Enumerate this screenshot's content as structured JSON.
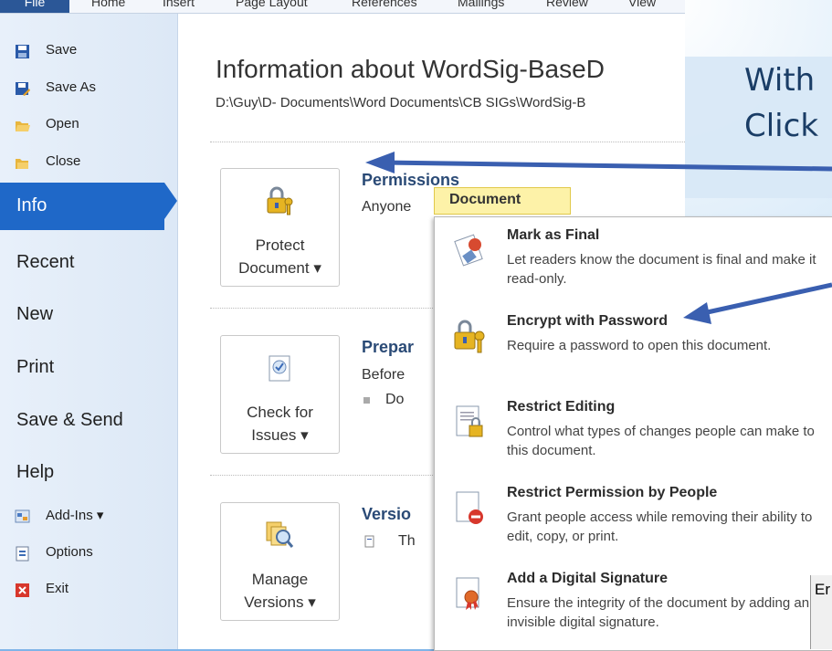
{
  "ribbon": {
    "tabs": [
      "File",
      "Home",
      "Insert",
      "Page Layout",
      "References",
      "Mailings",
      "Review",
      "View"
    ]
  },
  "sidebar": {
    "items": [
      {
        "label": "Save",
        "icon": "save-icon"
      },
      {
        "label": "Save As",
        "icon": "save-as-icon"
      },
      {
        "label": "Open",
        "icon": "open-folder-icon"
      },
      {
        "label": "Close",
        "icon": "close-folder-icon"
      },
      {
        "label": "Info"
      },
      {
        "label": "Recent"
      },
      {
        "label": "New"
      },
      {
        "label": "Print"
      },
      {
        "label": "Save & Send"
      },
      {
        "label": "Help"
      },
      {
        "label": "Add-Ins ▾",
        "icon": "add-ins-icon"
      },
      {
        "label": "Options",
        "icon": "options-icon"
      },
      {
        "label": "Exit",
        "icon": "exit-icon"
      }
    ]
  },
  "main": {
    "title": "Information about WordSig-BaseD",
    "path": "D:\\Guy\\D- Documents\\Word Documents\\CB SIGs\\WordSig-B",
    "sections": [
      {
        "button_line1": "Protect",
        "button_line2": "Document ▾",
        "heading": "Permissions",
        "text": "Anyone"
      },
      {
        "button_line1": "Check for",
        "button_line2": "Issues ▾",
        "heading": "Prepar",
        "text": "Before",
        "bullet": "Do"
      },
      {
        "button_line1": "Manage",
        "button_line2": "Versions ▾",
        "heading": "Versio",
        "text": "Th"
      }
    ]
  },
  "menu": {
    "tooltip": "Document",
    "items": [
      {
        "title": "Mark as Final",
        "desc": "Let readers know the document is final and make it read-only."
      },
      {
        "title": "Encrypt with Password",
        "desc": "Require a password to open this document."
      },
      {
        "title": "Restrict Editing",
        "desc": "Control what types of changes people can make to this document."
      },
      {
        "title": "Restrict Permission by People",
        "desc": "Grant people access while removing their ability to edit, copy, or print."
      },
      {
        "title": "Add a Digital Signature",
        "desc": "Ensure the integrity of the document by adding an invisible digital signature."
      }
    ]
  },
  "slide": {
    "line1": "With",
    "line2": "Click",
    "dialog_stub": "Er"
  },
  "colors": {
    "accent": "#1f68c8",
    "arrow": "#3a5fb0"
  }
}
